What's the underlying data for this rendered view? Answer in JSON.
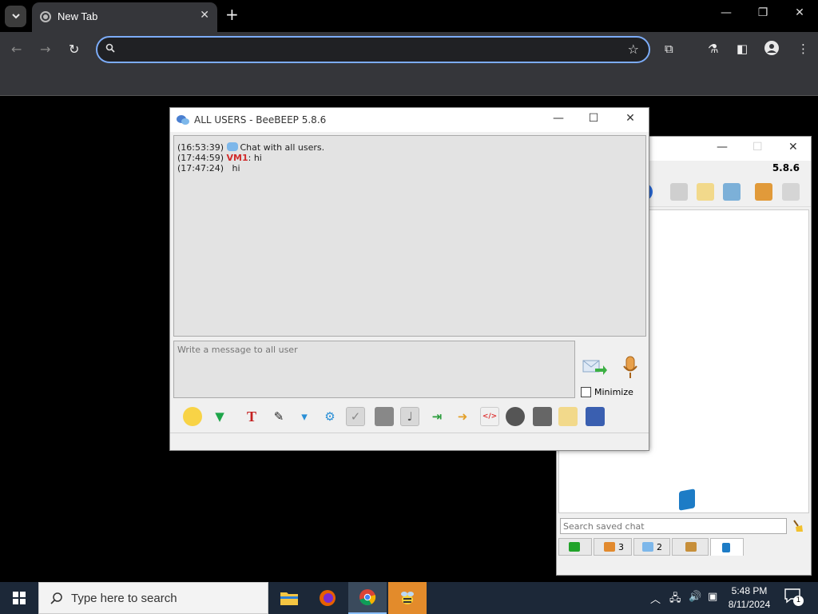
{
  "browser": {
    "tab_title": "New Tab",
    "omnibox_value": "",
    "colors": {
      "tab_bg": "#35363a",
      "omnibox_border": "#7cacf8"
    }
  },
  "main_window": {
    "version": "5.8.6",
    "search_placeholder": "Search saved chat",
    "tabs": [
      {
        "icon": "network-icon",
        "count": ""
      },
      {
        "icon": "users-icon",
        "count": "3"
      },
      {
        "icon": "chats-icon",
        "count": "2"
      },
      {
        "icon": "groups-icon",
        "count": ""
      },
      {
        "icon": "saved-chat-icon",
        "count": ""
      }
    ]
  },
  "chat_window": {
    "title": "ALL USERS - BeeBEEP 5.8.6",
    "messages": [
      {
        "time": "(16:53:39)",
        "user": "",
        "text": "Chat with all users.",
        "system": true
      },
      {
        "time": "(17:44:59)",
        "user": "VM1",
        "text": ": hi",
        "system": false
      },
      {
        "time": "(17:47:24)",
        "user": "",
        "text": "hi",
        "system": false
      }
    ],
    "compose_placeholder": "Write a message to all user",
    "minimize_label": "Minimize",
    "toolbar_icons": [
      "emoticons-icon",
      "dropdown-arrow-icon",
      "font-icon",
      "color-picker-icon",
      "filter-icon",
      "settings-gear-icon",
      "spellcheck-icon",
      "text-style-icon",
      "note-icon",
      "export-icon",
      "send-file-icon",
      "html-icon",
      "record-icon",
      "screenshot-icon",
      "notepad-icon",
      "save-chat-icon"
    ]
  },
  "taskbar": {
    "search_text": "Type here to search",
    "time": "5:48 PM",
    "date": "8/11/2024",
    "notification_count": "1"
  }
}
